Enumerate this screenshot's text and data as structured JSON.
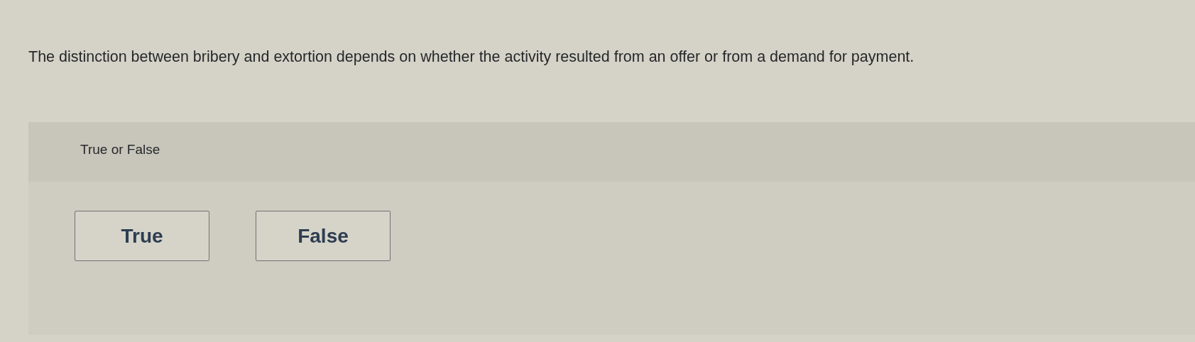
{
  "question": {
    "text": "The distinction between bribery and extortion depends on whether the activity resulted from an offer or from a demand for payment."
  },
  "answer_panel": {
    "prompt": "True or False",
    "options": [
      {
        "label": "True",
        "selected": false
      },
      {
        "label": "False",
        "selected": false
      }
    ]
  }
}
